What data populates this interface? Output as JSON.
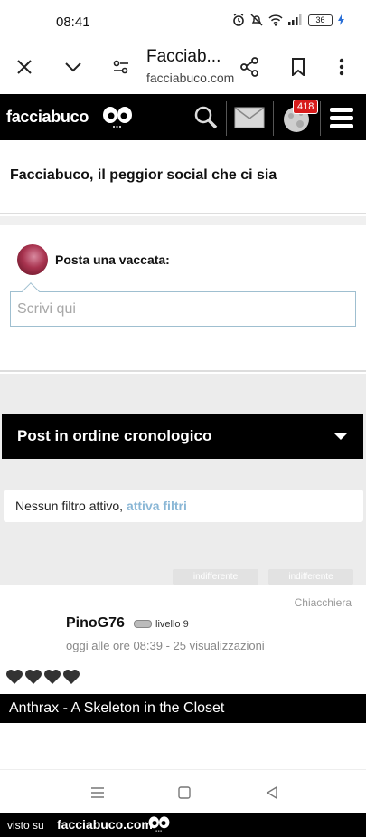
{
  "status_bar": {
    "time": "08:41",
    "battery": "36"
  },
  "browser": {
    "title": "Facciab...",
    "url": "facciabuco.com"
  },
  "site_header": {
    "logo": "facciabuco",
    "notifications_count": "418"
  },
  "page": {
    "title": "Facciabuco, il peggior social che ci sia"
  },
  "composer": {
    "label": "Posta una vaccata:",
    "placeholder": "Scrivi qui",
    "value": ""
  },
  "feed": {
    "order_label": "Post in ordine cronologico",
    "filter_text": "Nessun filtro attivo, ",
    "filter_link": "attiva filtri",
    "vote_buttons": [
      "indifferente",
      "indifferente"
    ]
  },
  "post": {
    "category": "Chiacchiera",
    "author": "PinoG76",
    "level": "livello 9",
    "meta": "oggi alle ore 08:39 - 25 visualizzazioni",
    "hearts": [
      "🖤",
      "🖤",
      "🖤",
      "🖤"
    ],
    "song": "Anthrax - A Skeleton in the Closet"
  },
  "watermark": {
    "prefix": "visto su",
    "site": "facciabuco.com"
  },
  "colors": {
    "header_bg": "#000000",
    "link": "#8ab7d6",
    "badge": "#d81c1c",
    "input_border": "#9fbfd0"
  }
}
